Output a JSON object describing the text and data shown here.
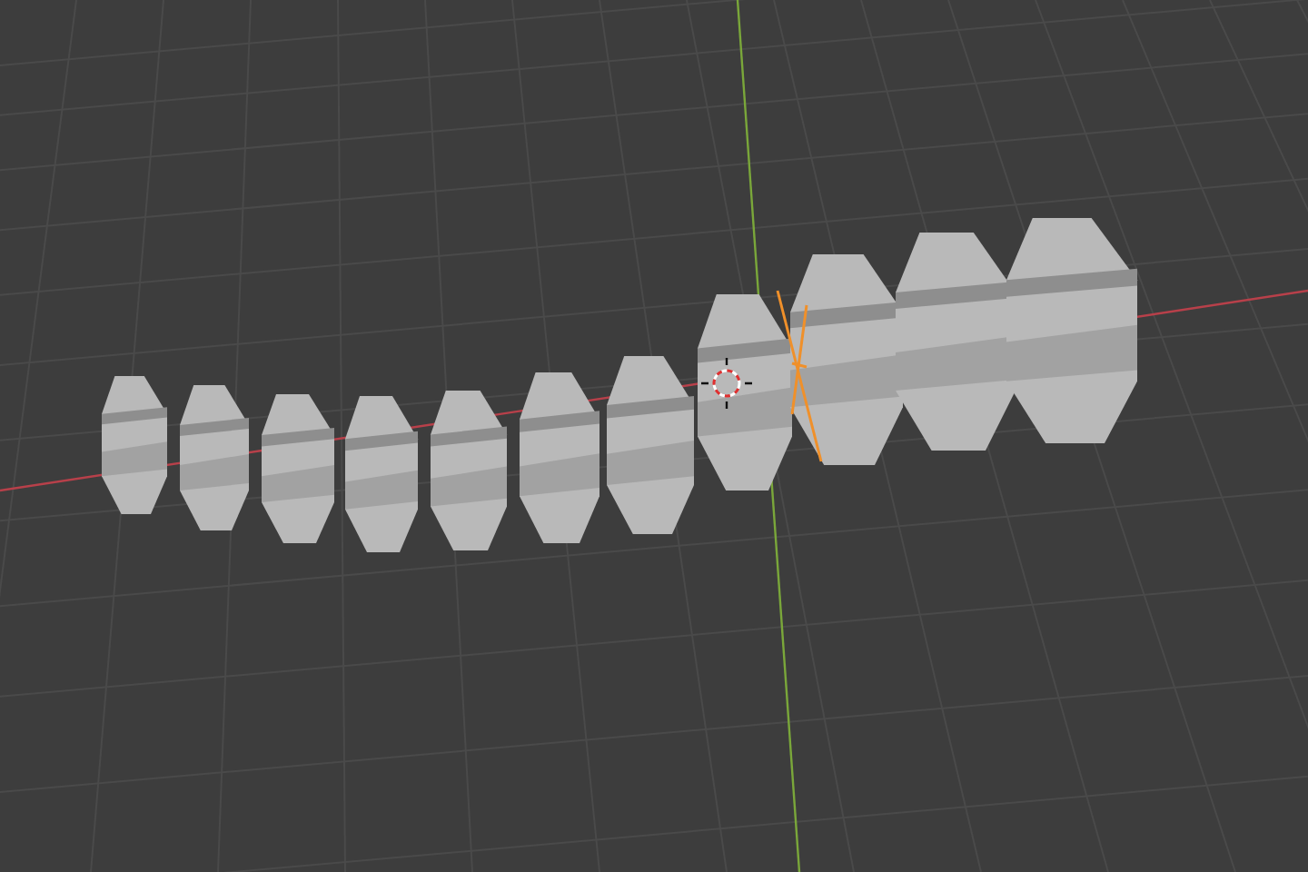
{
  "viewport": {
    "kind": "perspective",
    "objects": [
      {
        "kind": "segment",
        "selected": false
      },
      {
        "kind": "segment",
        "selected": false
      },
      {
        "kind": "segment",
        "selected": false
      },
      {
        "kind": "segment",
        "selected": false
      },
      {
        "kind": "segment",
        "selected": false
      },
      {
        "kind": "segment",
        "selected": false
      },
      {
        "kind": "segment",
        "selected": false
      },
      {
        "kind": "segment",
        "selected": false
      },
      {
        "kind": "plate",
        "selected": true
      },
      {
        "kind": "segment",
        "selected": false
      },
      {
        "kind": "segment",
        "selected": false
      },
      {
        "kind": "segment",
        "selected": false
      }
    ]
  }
}
